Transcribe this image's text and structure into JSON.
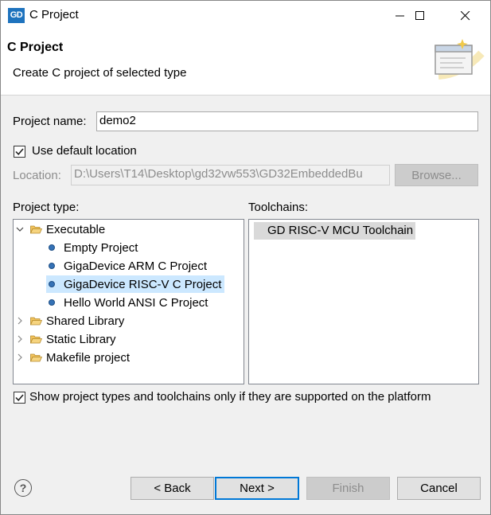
{
  "window": {
    "app_icon_text": "GD",
    "title": "C Project"
  },
  "header": {
    "title": "C Project",
    "description": "Create C project of selected type"
  },
  "form": {
    "project_name_label": "Project name:",
    "project_name_value": "demo2",
    "use_default_location_label": "Use default location",
    "use_default_location_checked": true,
    "location_label": "Location:",
    "location_value": "D:\\Users\\T14\\Desktop\\gd32vw553\\GD32EmbeddedBu",
    "browse_label": "Browse..."
  },
  "project_types": {
    "label": "Project type:",
    "items": [
      {
        "label": "Executable",
        "kind": "folder",
        "expanded": true,
        "level": 0
      },
      {
        "label": "Empty Project",
        "kind": "leaf",
        "level": 1
      },
      {
        "label": "GigaDevice ARM C Project",
        "kind": "leaf",
        "level": 1
      },
      {
        "label": "GigaDevice RISC-V C Project",
        "kind": "leaf",
        "level": 1,
        "selected": true
      },
      {
        "label": "Hello World ANSI C Project",
        "kind": "leaf",
        "level": 1
      },
      {
        "label": "Shared Library",
        "kind": "folder",
        "expanded": false,
        "level": 0
      },
      {
        "label": "Static Library",
        "kind": "folder",
        "expanded": false,
        "level": 0
      },
      {
        "label": "Makefile project",
        "kind": "folder",
        "expanded": false,
        "level": 0
      }
    ]
  },
  "toolchains": {
    "label": "Toolchains:",
    "items": [
      "GD RISC-V MCU Toolchain"
    ]
  },
  "filter": {
    "label": "Show project types and toolchains only if they are supported on the platform",
    "checked": true
  },
  "footer": {
    "back_label": "< Back",
    "next_label": "Next >",
    "finish_label": "Finish",
    "cancel_label": "Cancel",
    "help_icon": "?"
  },
  "colors": {
    "selection": "#cce8ff",
    "accent": "#0078d7",
    "leaf_icon": "#3572b6",
    "folder_icon": "#e8b84a"
  }
}
